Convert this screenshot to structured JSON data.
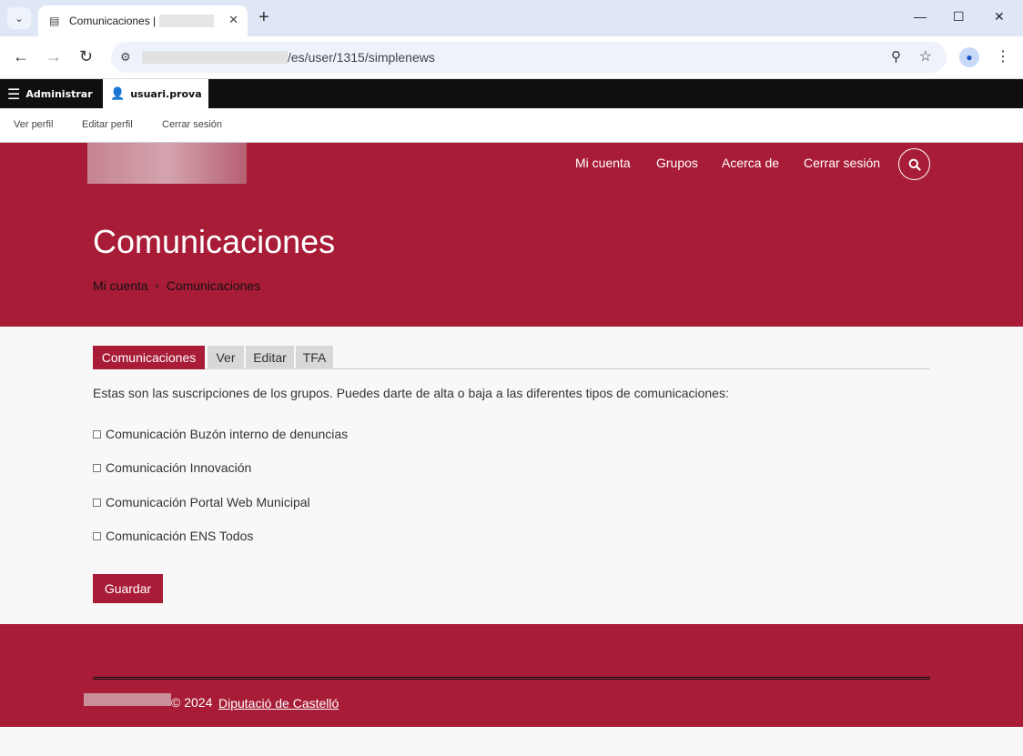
{
  "browser": {
    "tab_title": "Comunicaciones |",
    "url_path": "/es/user/1315/simplenews"
  },
  "admin_toolbar": {
    "admin_label": "Administrar",
    "user_label": "usuari.prova",
    "sub_links": [
      "Ver perfil",
      "Editar perfil",
      "Cerrar sesión"
    ]
  },
  "header": {
    "nav": [
      "Mi cuenta",
      "Grupos",
      "Acerca de",
      "Cerrar sesión"
    ],
    "title": "Comunicaciones",
    "breadcrumb": [
      "Mi cuenta",
      "Comunicaciones"
    ]
  },
  "content": {
    "tabs": [
      "Comunicaciones",
      "Ver",
      "Editar",
      "TFA"
    ],
    "intro": "Estas son las suscripciones de los grupos. Puedes darte de alta o baja a las diferentes tipos de comunicaciones:",
    "options": [
      "Comunicación Buzón interno de denuncias",
      "Comunicación Innovación",
      "Comunicación Portal Web Municipal",
      "Comunicación ENS Todos"
    ],
    "save_label": "Guardar"
  },
  "footer": {
    "copy": "© 2024",
    "link": "Diputació de Castelló"
  },
  "colors": {
    "brand": "#a81c37",
    "admin_bar": "#0f0f0f"
  }
}
